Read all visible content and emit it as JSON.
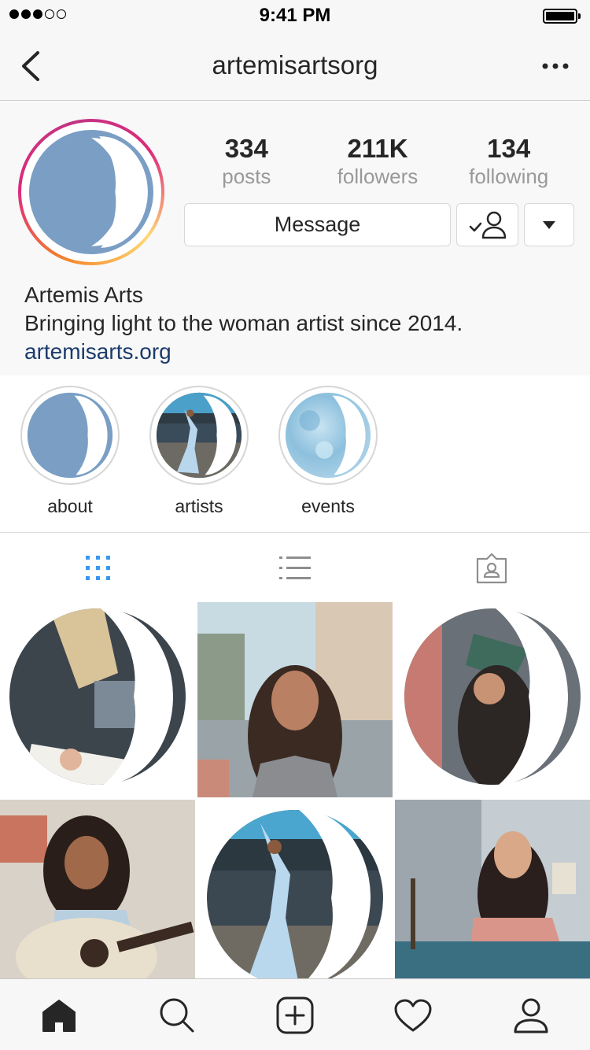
{
  "status_bar": {
    "time": "9:41 PM",
    "signal_bars_filled": 3,
    "signal_bars_total": 5,
    "battery_level": 1.0
  },
  "nav": {
    "title": "artemisartsorg",
    "back_icon": "chevron-left-icon",
    "more_icon": "more-horizontal-icon"
  },
  "profile": {
    "stats": [
      {
        "value": "334",
        "label": "posts"
      },
      {
        "value": "211K",
        "label": "followers"
      },
      {
        "value": "134",
        "label": "following"
      }
    ],
    "message_label": "Message",
    "name": "Artemis Arts",
    "bio": "Bringing light to the woman artist since 2014.",
    "link": "artemisarts.org"
  },
  "highlights": [
    {
      "label": "about"
    },
    {
      "label": "artists"
    },
    {
      "label": "events"
    }
  ],
  "tabs": [
    "grid-icon",
    "list-icon",
    "tagged-icon"
  ],
  "bottom_nav": [
    "home-icon",
    "search-icon",
    "add-icon",
    "heart-icon",
    "profile-icon"
  ],
  "colors": {
    "moon_blue": "#7a9ec4",
    "link": "#1c3a6b",
    "active_tab": "#3897f0",
    "ring_start": "#f58529",
    "ring_end": "#c13584"
  }
}
